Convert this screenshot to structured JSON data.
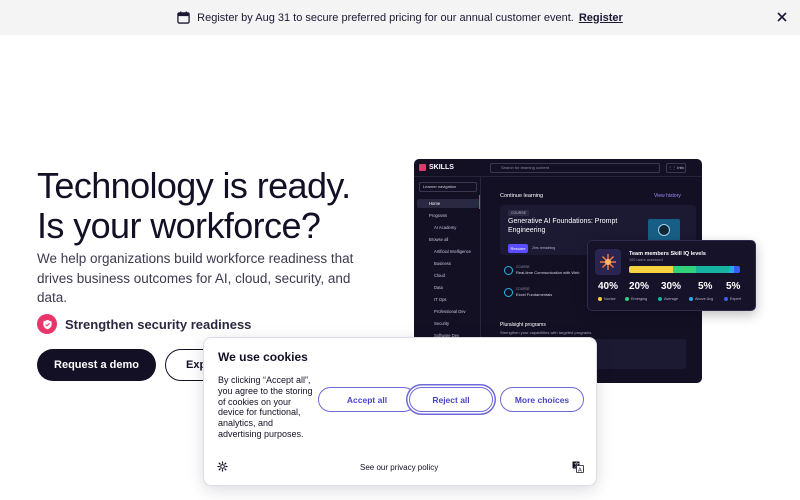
{
  "banner": {
    "icon": "calendar-icon",
    "text": "Register by Aug 31 to secure preferred pricing for our annual customer event.",
    "link": "Register",
    "close_icon": "close-icon"
  },
  "hero": {
    "title_line1": "Technology is ready.",
    "title_line2": "Is your workforce?",
    "subtitle": "We help organizations build workforce readiness that drives business outcomes for AI, cloud, security, and data.",
    "feature_icon": "shield-icon",
    "feature_label": "Strengthen security readiness",
    "primary_button": "Request a demo",
    "secondary_button": "Exp"
  },
  "mock": {
    "logo": "SKILLS",
    "search_placeholder": "Search for learning content",
    "grid_label": "⋮⋮ Info",
    "nav_header": "Learner navigation",
    "nav": {
      "home": "Home",
      "programs": "Programs",
      "ai_academy": "AI Academy",
      "browse_all": "Browse all",
      "ai": "Artificial Intelligence",
      "business": "Business",
      "cloud": "Cloud",
      "data": "Data",
      "it_ops": "IT Ops",
      "prof_dev": "Professional Dev",
      "security": "Security",
      "software_dev": "Software Dev"
    },
    "continue_learning": "Continue learning",
    "view_history": "View history",
    "course_tag": "COURSE",
    "course_name": "Generative AI Foundations: Prompt Engineering",
    "resume": "Resume",
    "remaining": "2hrs remaining",
    "mini_course1_tag": "COURSE",
    "mini_course1_name": "Real-time Communication with Web",
    "mini_course2_tag": "COURSE",
    "mini_course2_name": "Excel Fundamentals",
    "programs_title": "Pluralsight programs",
    "programs_sub": "Strengthen your capabilities with targeted programs"
  },
  "skill_card": {
    "title": "Team members Skill IQ levels",
    "subtitle": "100 users assessed",
    "colors": {
      "novice": "#f6d23e",
      "emerging": "#33d17a",
      "average": "#16b3a1",
      "above_avg": "#2aa8e8",
      "expert": "#3a5cf0"
    },
    "levels": [
      {
        "pct": "40%",
        "label": "Novice",
        "value": 40
      },
      {
        "pct": "20%",
        "label": "Emerging",
        "value": 20
      },
      {
        "pct": "30%",
        "label": "Average",
        "value": 30
      },
      {
        "pct": "5%",
        "label": "Above Avg",
        "value": 5
      },
      {
        "pct": "5%",
        "label": "Expert",
        "value": 5
      }
    ]
  },
  "cookie": {
    "title": "We use cookies",
    "body": "By clicking “Accept all”, you agree to the storing of cookies on your device for functional, analytics, and advertising purposes.",
    "accept": "Accept all",
    "reject": "Reject all",
    "more": "More choices",
    "policy": "See our privacy policy",
    "settings_icon": "gear-icon",
    "language_icon": "translate-icon"
  }
}
